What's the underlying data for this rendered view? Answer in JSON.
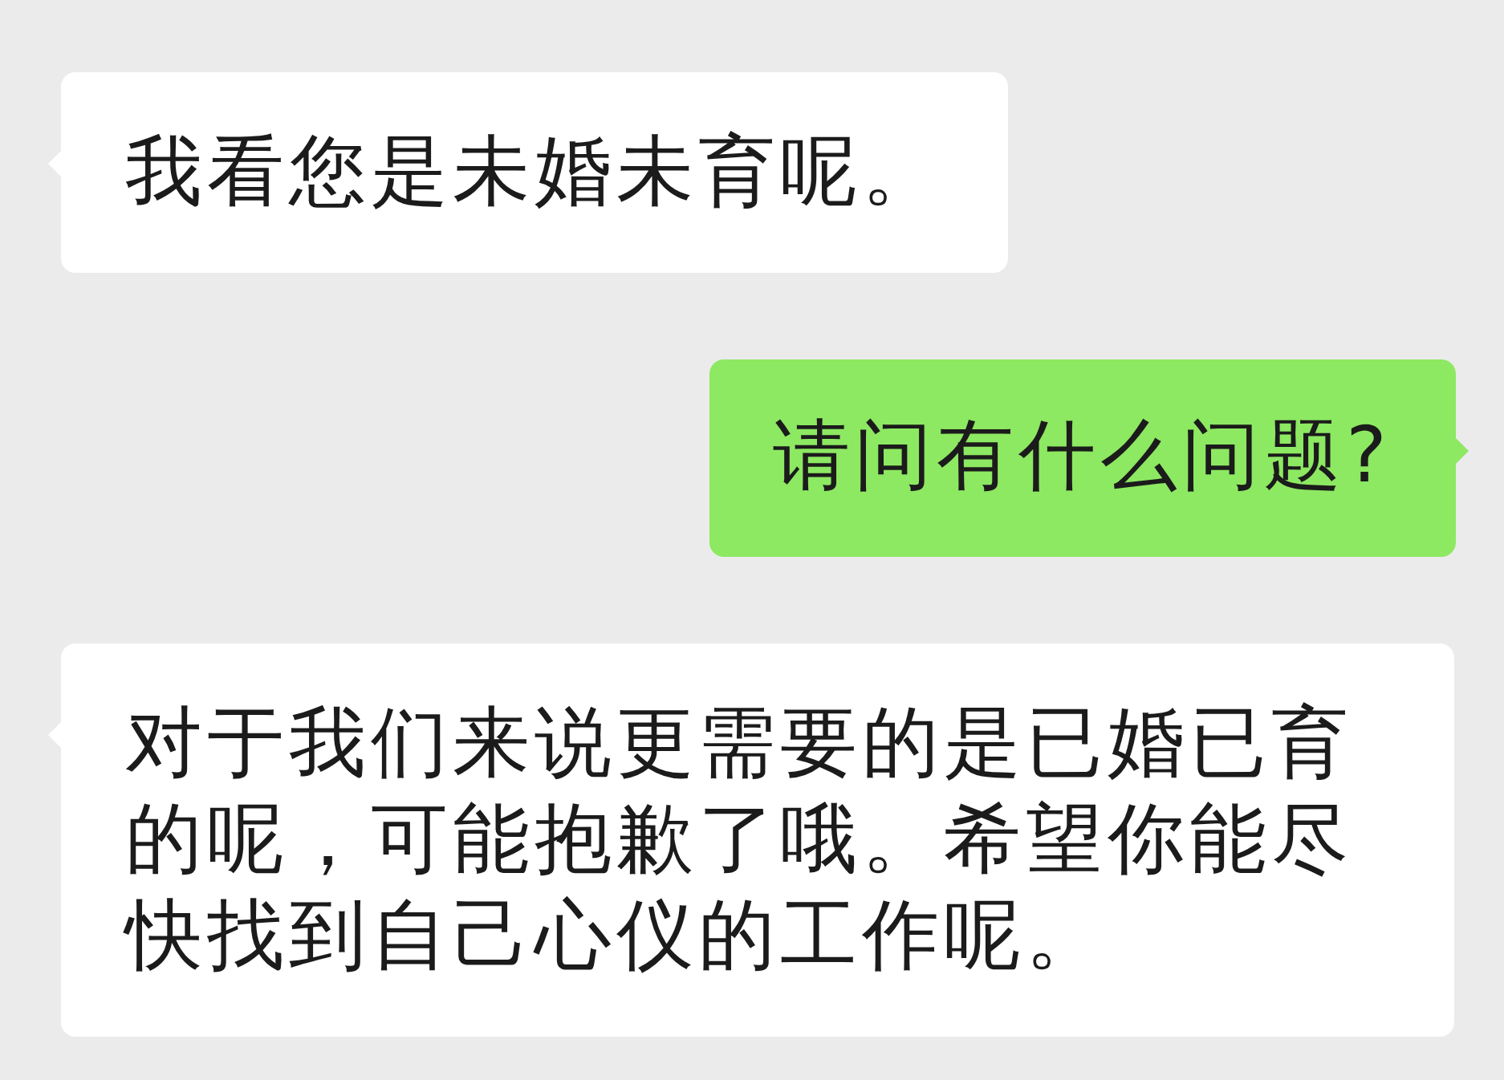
{
  "messages": [
    {
      "kind": "received",
      "text": "我看您是未婚未育呢。"
    },
    {
      "kind": "sent",
      "text": "请问有什么问题?"
    },
    {
      "kind": "received",
      "text": "对于我们来说更需要的是已婚已育的呢，可能抱歉了哦。希望你能尽快找到自己心仪的工作呢。"
    }
  ]
}
